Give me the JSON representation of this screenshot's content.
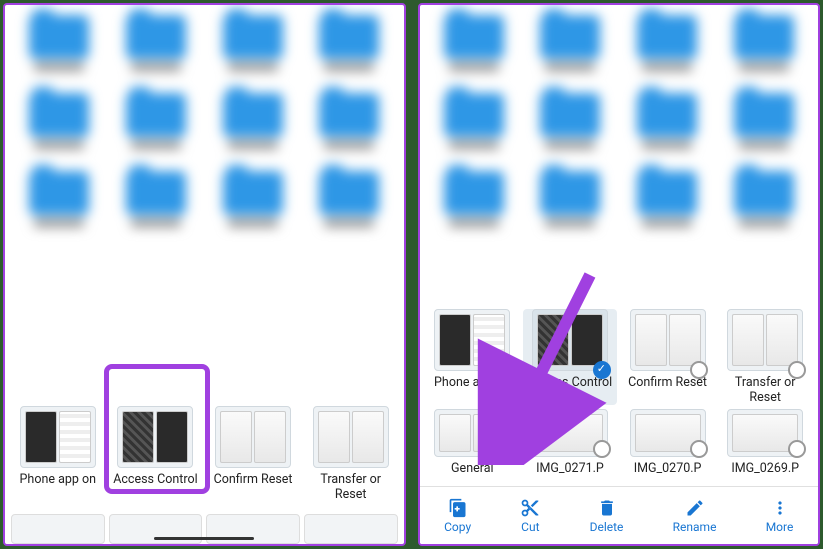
{
  "left_screen": {
    "files": [
      {
        "name": "Phone app on"
      },
      {
        "name": "Access Control",
        "highlighted": true
      },
      {
        "name": "Confirm Reset"
      },
      {
        "name": "Transfer or Reset"
      }
    ]
  },
  "right_screen": {
    "files_row1": [
      {
        "name": "Phone app on",
        "checked": false
      },
      {
        "name": "Access Control",
        "checked": true,
        "selected": true
      },
      {
        "name": "Confirm Reset",
        "checked": false
      },
      {
        "name": "Transfer or Reset",
        "checked": false
      }
    ],
    "files_row2": [
      {
        "name": "General",
        "checked": false
      },
      {
        "name": "IMG_0271.P",
        "checked": false
      },
      {
        "name": "IMG_0270.P",
        "checked": false
      },
      {
        "name": "IMG_0269.P",
        "checked": false
      }
    ],
    "actions": [
      {
        "id": "copy",
        "label": "Copy"
      },
      {
        "id": "cut",
        "label": "Cut"
      },
      {
        "id": "delete",
        "label": "Delete"
      },
      {
        "id": "rename",
        "label": "Rename"
      },
      {
        "id": "more",
        "label": "More"
      }
    ]
  },
  "colors": {
    "accent_purple": "#a040e0",
    "action_blue": "#1976d2",
    "folder_blue": "#2e97e6"
  }
}
